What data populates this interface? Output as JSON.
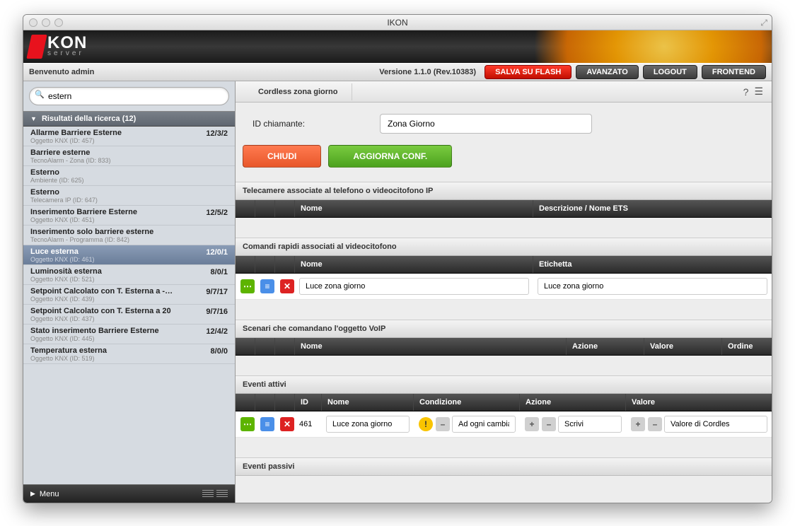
{
  "window": {
    "title": "IKON"
  },
  "brand": {
    "name": "KON",
    "sub": "server"
  },
  "toolbar": {
    "welcome": "Benvenuto admin",
    "version": "Versione 1.1.0 (Rev.10383)",
    "save": "SALVA SU FLASH",
    "advanced": "AVANZATO",
    "logout": "LOGOUT",
    "frontend": "FRONTEND"
  },
  "search": {
    "value": "estern"
  },
  "results_header": "Risultati della ricerca (12)",
  "results": [
    {
      "name": "Allarme Barriere Esterne",
      "sub": "Oggetto KNX (ID: 457)",
      "addr": "12/3/2"
    },
    {
      "name": "Barriere esterne",
      "sub": "TecnoAlarm - Zona (ID: 833)",
      "addr": ""
    },
    {
      "name": "Esterno",
      "sub": "Ambiente (ID: 625)",
      "addr": ""
    },
    {
      "name": "Esterno",
      "sub": "Telecamera IP (ID: 647)",
      "addr": ""
    },
    {
      "name": "Inserimento Barriere Esterne",
      "sub": "Oggetto KNX (ID: 451)",
      "addr": "12/5/2"
    },
    {
      "name": "Inserimento solo barriere esterne",
      "sub": "TecnoAlarm - Programma (ID: 842)",
      "addr": ""
    },
    {
      "name": "Luce esterna",
      "sub": "Oggetto KNX (ID: 461)",
      "addr": "12/0/1",
      "selected": true
    },
    {
      "name": "Luminosità  esterna",
      "sub": "Oggetto KNX (ID: 521)",
      "addr": "8/0/1"
    },
    {
      "name": "Setpoint Calcolato con T. Esterna a -…",
      "sub": "Oggetto KNX (ID: 439)",
      "addr": "9/7/17"
    },
    {
      "name": "Setpoint Calcolato con T. Esterna a 20",
      "sub": "Oggetto KNX (ID: 437)",
      "addr": "9/7/16"
    },
    {
      "name": "Stato inserimento Barriere Esterne",
      "sub": "Oggetto KNX (ID: 445)",
      "addr": "12/4/2"
    },
    {
      "name": "Temperatura esterna",
      "sub": "Oggetto KNX (ID: 519)",
      "addr": "8/0/0"
    }
  ],
  "menu": {
    "label": "Menu"
  },
  "tab": {
    "label": "Cordless zona giorno"
  },
  "form": {
    "caller_label": "ID chiamante:",
    "caller_value": "Zona Giorno",
    "close": "CHIUDI",
    "update": "AGGIORNA CONF."
  },
  "panels": {
    "cameras": {
      "title": "Telecamere associate al telefono o videocitofono IP",
      "cols": {
        "name": "Nome",
        "desc": "Descrizione / Nome ETS"
      }
    },
    "commands": {
      "title": "Comandi rapidi associati al videocitofono",
      "cols": {
        "name": "Nome",
        "label": "Etichetta"
      },
      "rows": [
        {
          "name": "Luce zona giorno",
          "label": "Luce zona giorno"
        }
      ]
    },
    "scenarios": {
      "title": "Scenari che comandano l'oggetto VoIP",
      "cols": {
        "name": "Nome",
        "action": "Azione",
        "value": "Valore",
        "order": "Ordine"
      }
    },
    "active": {
      "title": "Eventi attivi",
      "cols": {
        "id": "ID",
        "name": "Nome",
        "cond": "Condizione",
        "action": "Azione",
        "value": "Valore"
      },
      "rows": [
        {
          "id": "461",
          "name": "Luce zona giorno",
          "cond": "Ad ogni cambiam",
          "action": "Scrivi",
          "value": "Valore di Cordles"
        }
      ]
    },
    "passive": {
      "title": "Eventi passivi"
    }
  }
}
